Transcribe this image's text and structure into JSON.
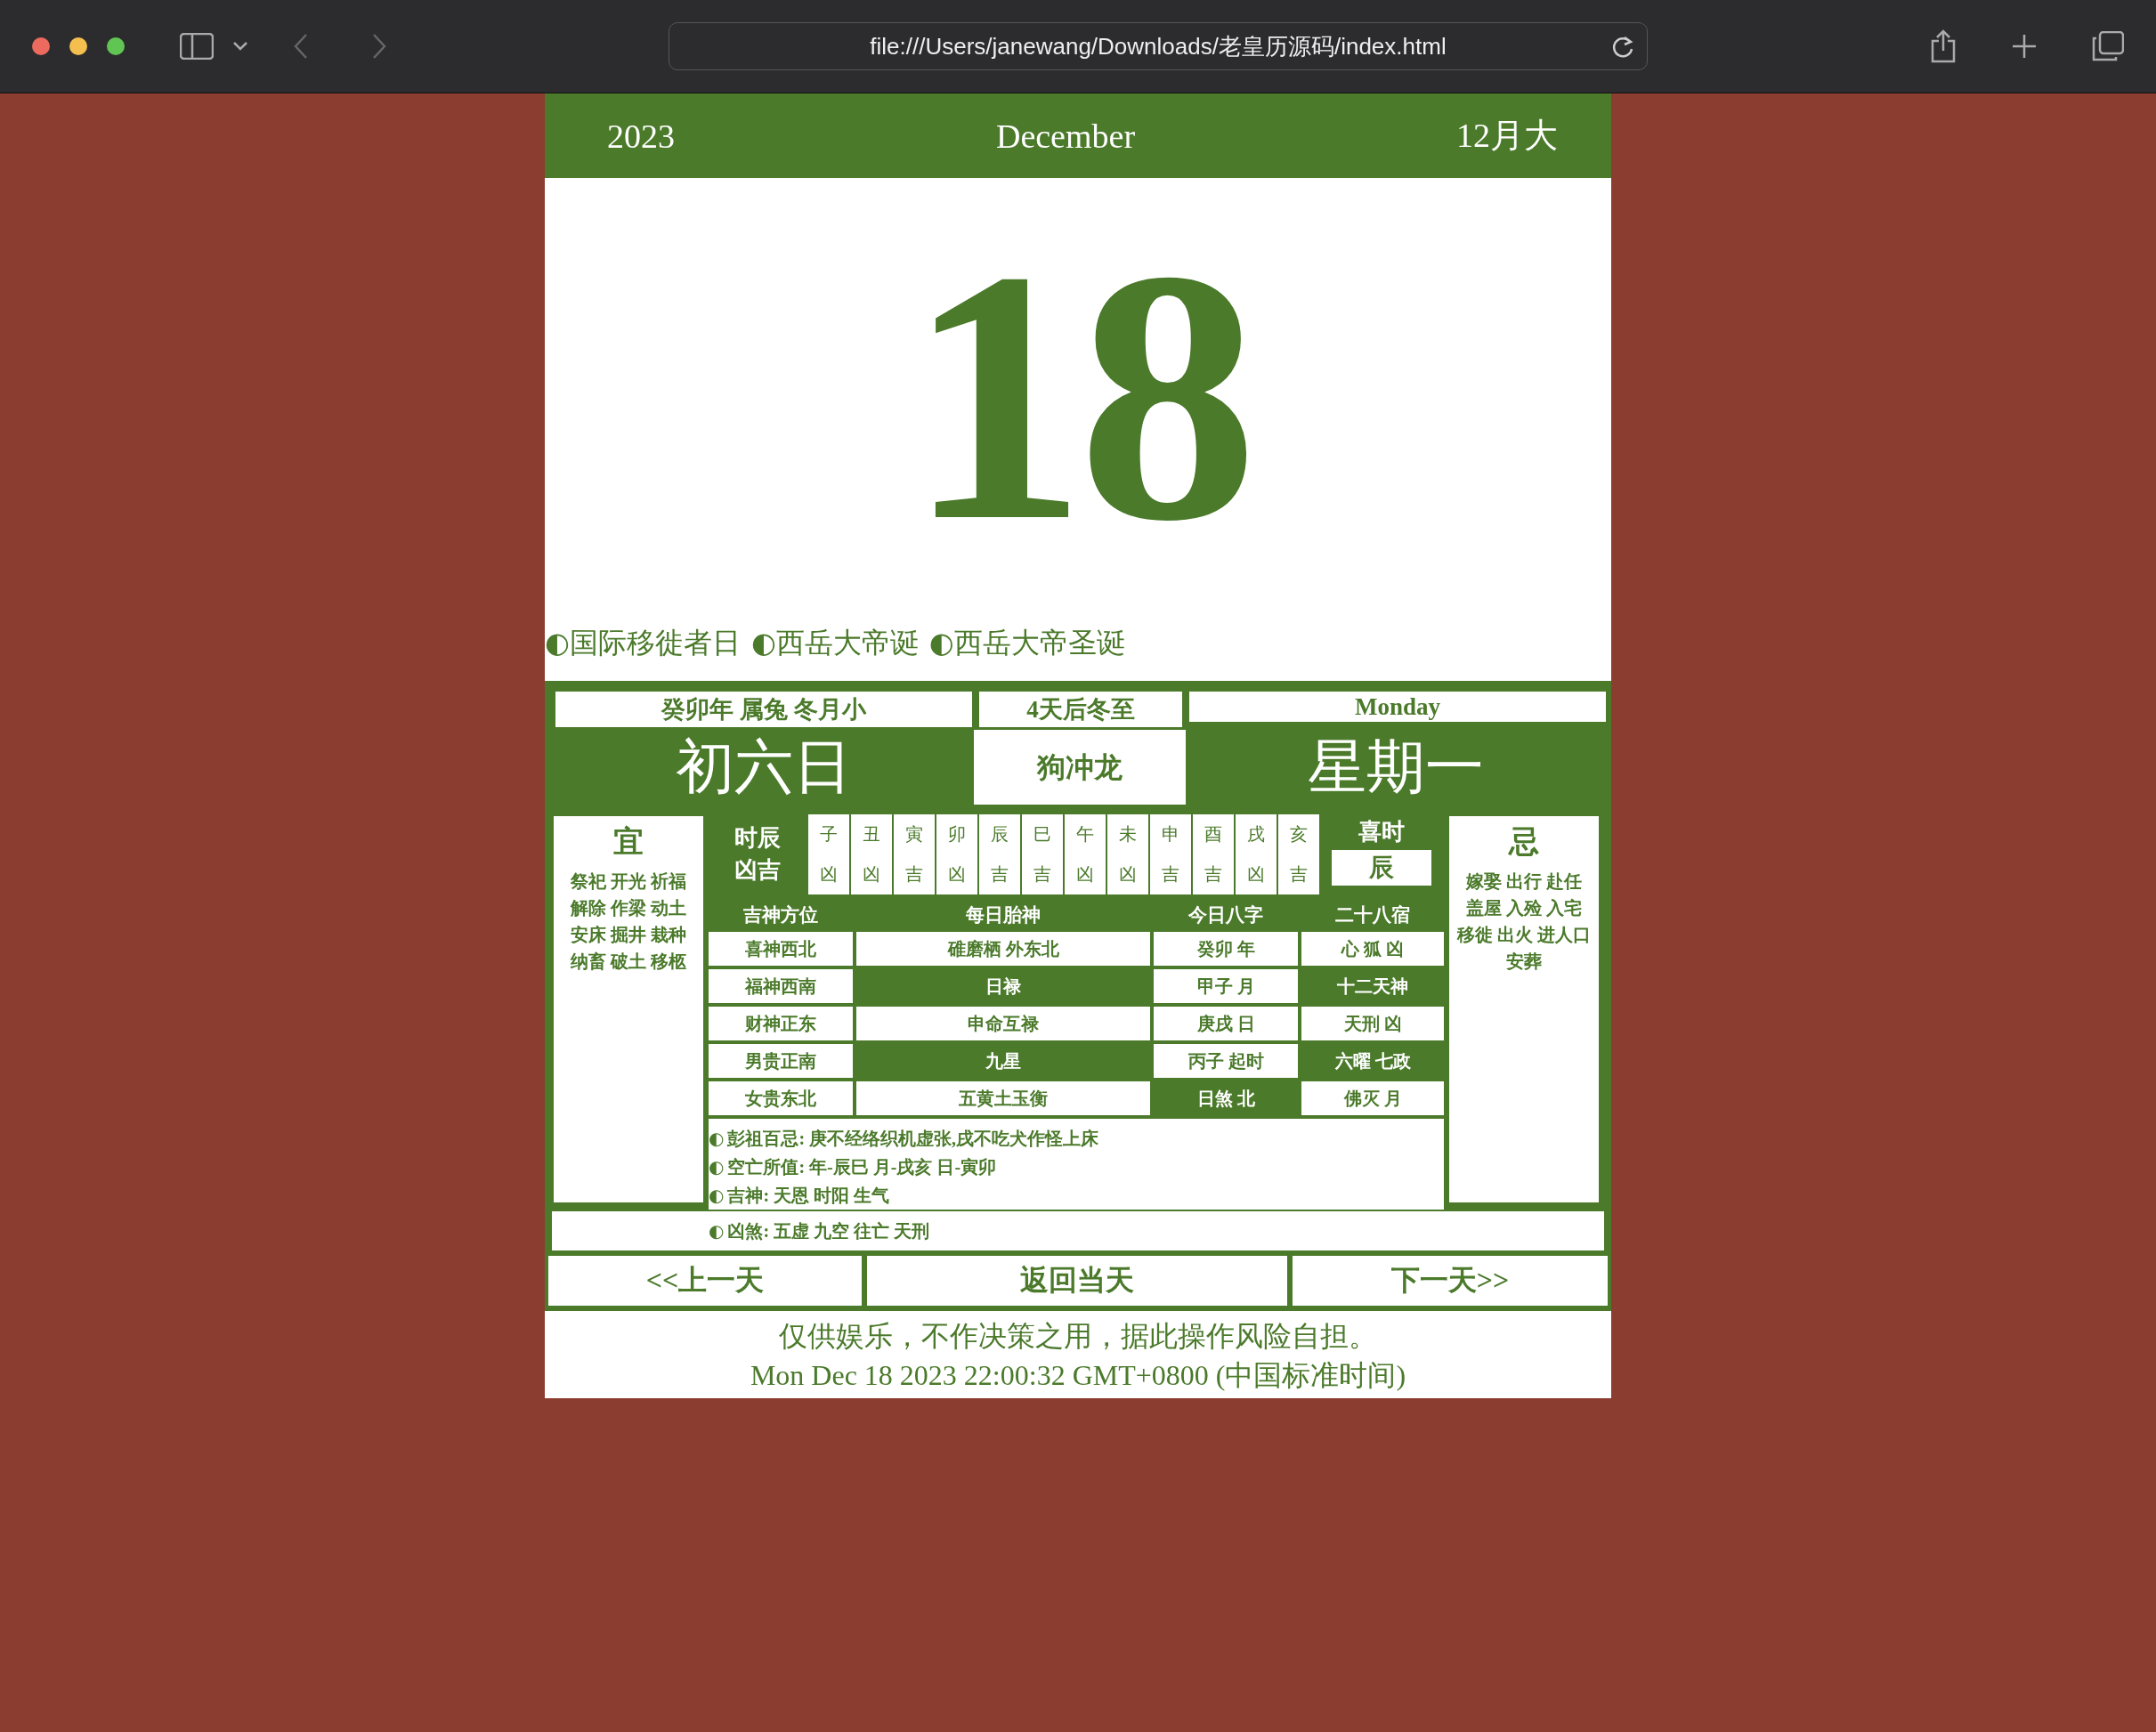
{
  "browser": {
    "url": "file:///Users/janewang/Downloads/老皇历源码/index.html"
  },
  "header": {
    "year": "2023",
    "month": "December",
    "lunar_month": "12月大"
  },
  "day": "18",
  "festivals": [
    {
      "marker": "◐",
      "name": "国际移徙者日"
    },
    {
      "marker": "◐",
      "name": "西岳大帝诞"
    },
    {
      "marker": "◐",
      "name": "西岳大帝圣诞"
    }
  ],
  "lunar": {
    "year_info": "癸卯年 属兔 冬月小",
    "solar_term": "4天后冬至",
    "weekday_en": "Monday",
    "lunar_day": "初六日",
    "clash": "狗冲龙",
    "weekday": "星期一"
  },
  "yi": {
    "title": "宜",
    "lines": [
      "祭祀 开光 祈福",
      "解除 作梁 动土",
      "安床 掘井 栽种",
      "纳畜 破土 移柩"
    ]
  },
  "ji": {
    "title": "忌",
    "lines": [
      "嫁娶 出行 赴任",
      "盖屋 入殓 入宅",
      "移徙 出火 进人口",
      "安葬"
    ]
  },
  "hours": {
    "label_1": "时辰",
    "label_2": "凶吉",
    "items": [
      {
        "branch": "子",
        "fortune": "凶"
      },
      {
        "branch": "丑",
        "fortune": "凶"
      },
      {
        "branch": "寅",
        "fortune": "吉"
      },
      {
        "branch": "卯",
        "fortune": "凶"
      },
      {
        "branch": "辰",
        "fortune": "吉"
      },
      {
        "branch": "巳",
        "fortune": "吉"
      },
      {
        "branch": "午",
        "fortune": "凶"
      },
      {
        "branch": "未",
        "fortune": "凶"
      },
      {
        "branch": "申",
        "fortune": "吉"
      },
      {
        "branch": "酉",
        "fortune": "吉"
      },
      {
        "branch": "戌",
        "fortune": "凶"
      },
      {
        "branch": "亥",
        "fortune": "吉"
      }
    ]
  },
  "lucky_hour": {
    "title": "喜时",
    "value": "辰"
  },
  "table": {
    "columns": [
      "吉神方位",
      "每日胎神",
      "今日八字",
      "二十八宿"
    ],
    "rows": [
      [
        {
          "text": "喜神西北",
          "highlighted": false
        },
        {
          "text": "碓磨栖 外东北",
          "highlighted": false
        },
        {
          "text": "癸卯 年",
          "highlighted": false
        },
        {
          "text": "心 狐 凶",
          "highlighted": false
        }
      ],
      [
        {
          "text": "福神西南",
          "highlighted": false
        },
        {
          "text": "日禄",
          "highlighted": true
        },
        {
          "text": "甲子 月",
          "highlighted": false
        },
        {
          "text": "十二天神",
          "highlighted": true
        }
      ],
      [
        {
          "text": "财神正东",
          "highlighted": false
        },
        {
          "text": "申命互禄",
          "highlighted": false
        },
        {
          "text": "庚戌 日",
          "highlighted": false
        },
        {
          "text": "天刑 凶",
          "highlighted": false
        }
      ],
      [
        {
          "text": "男贵正南",
          "highlighted": false
        },
        {
          "text": "九星",
          "highlighted": true
        },
        {
          "text": "丙子 起时",
          "highlighted": false
        },
        {
          "text": "六曜 七政",
          "highlighted": true
        }
      ],
      [
        {
          "text": "女贵东北",
          "highlighted": false
        },
        {
          "text": "五黄土玉衡",
          "highlighted": false
        },
        {
          "text": "日煞 北",
          "highlighted": true
        },
        {
          "text": "佛灭 月",
          "highlighted": false
        }
      ]
    ]
  },
  "notes": [
    {
      "marker": "◐",
      "text": "彭祖百忌: 庚不经络织机虚张,戌不吃犬作怪上床"
    },
    {
      "marker": "◐",
      "text": "空亡所值: 年-辰巳 月-戌亥 日-寅卯"
    },
    {
      "marker": "◐",
      "text": "吉神: 天恩 时阳 生气"
    },
    {
      "marker": "◐",
      "text": "凶煞: 五虚 九空 往亡 天刑"
    }
  ],
  "nav": {
    "buttons": [
      "<<上一天",
      "返回当天",
      "下一天>>"
    ]
  },
  "footer": {
    "disclaimer": "仅供娱乐，不作决策之用，据此操作风险自担。",
    "timestamp": "Mon Dec 18 2023 22:00:32 GMT+0800 (中国标准时间)"
  }
}
